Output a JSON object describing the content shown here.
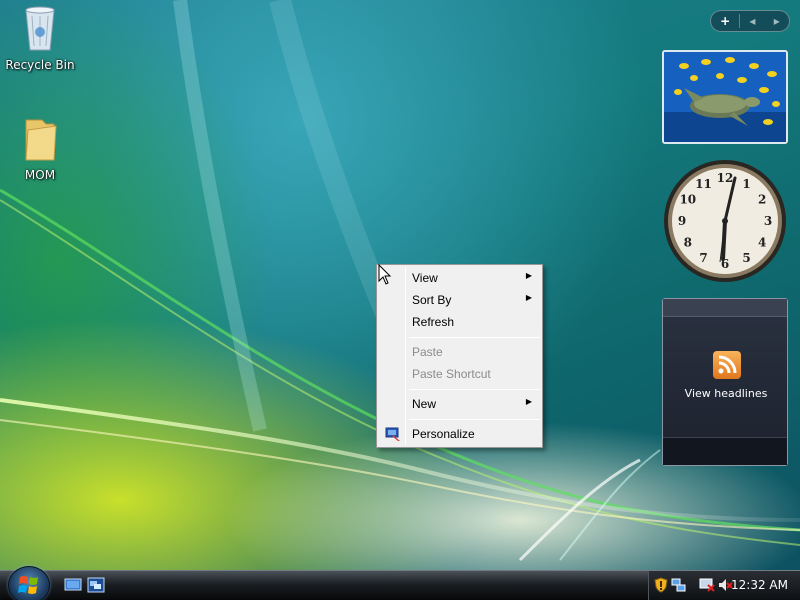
{
  "desktop": {
    "icons": [
      {
        "label": "Recycle Bin",
        "icon": "recycle-bin-icon"
      },
      {
        "label": "MOM",
        "icon": "folder-icon"
      }
    ]
  },
  "sidebar": {
    "controls": [
      "+",
      "◂",
      "▸"
    ],
    "feed_gadget": {
      "label": "View headlines",
      "icon": "rss-icon"
    },
    "clock_gadget": {
      "numbers": [
        "12",
        "1",
        "2",
        "3",
        "4",
        "5",
        "6",
        "7",
        "8",
        "9",
        "10",
        "11"
      ]
    }
  },
  "context_menu": {
    "items": [
      {
        "label": "View",
        "submenu": true,
        "enabled": true
      },
      {
        "label": "Sort By",
        "submenu": true,
        "enabled": true
      },
      {
        "label": "Refresh",
        "submenu": false,
        "enabled": true
      },
      {
        "label": "Paste",
        "submenu": false,
        "enabled": false
      },
      {
        "label": "Paste Shortcut",
        "submenu": false,
        "enabled": false
      },
      {
        "label": "New",
        "submenu": true,
        "enabled": true
      },
      {
        "label": "Personalize",
        "submenu": false,
        "enabled": true,
        "icon": "personalize-icon"
      }
    ]
  },
  "taskbar": {
    "clock": "12:32 AM",
    "tray_icons": [
      "security-shield-icon",
      "network-icon",
      "volume-muted-icon"
    ],
    "quick_launch": [
      "show-desktop-icon",
      "switch-windows-icon"
    ]
  },
  "colors": {
    "accent": "#1e7c8e",
    "menu_bg": "#f0f0f0",
    "disabled_text": "#8b8b8b"
  }
}
